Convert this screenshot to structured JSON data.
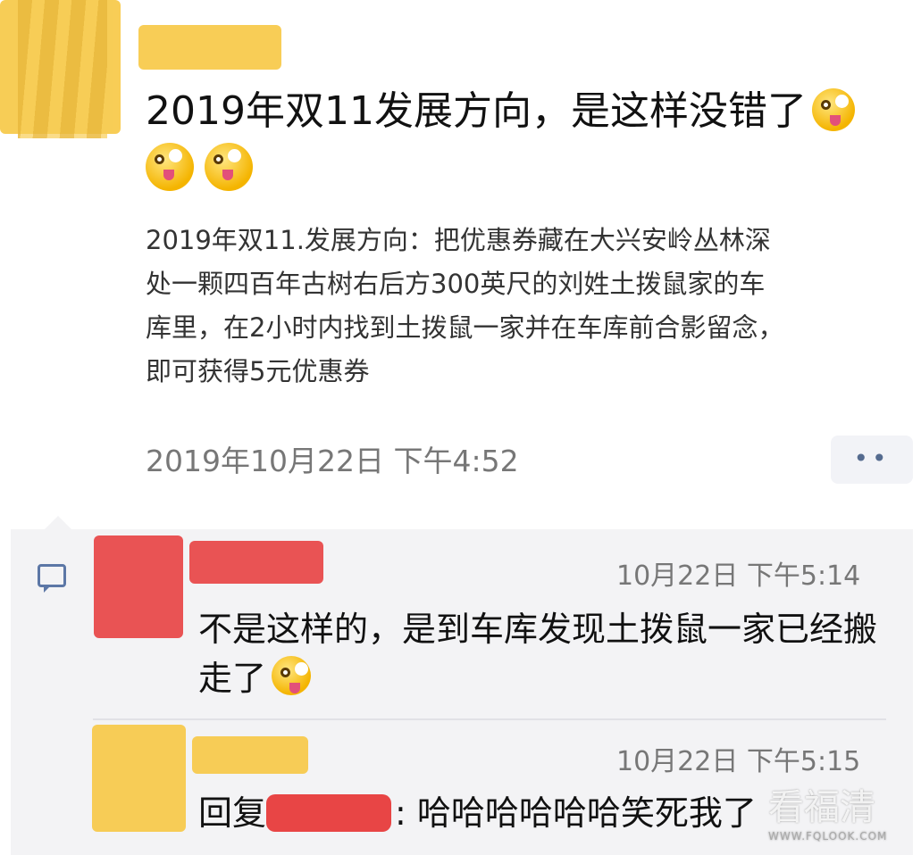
{
  "post": {
    "text": "2019年双11发展方向，是这样没错了",
    "link_text": "2019年双11.发展方向：把优惠券藏在大兴安岭丛林深处一颗四百年古树右后方300英尺的刘姓土拨鼠家的车库里，在2小时内找到土拨鼠一家并在车库前合影留念，即可获得5元优惠券",
    "timestamp": "2019年10月22日 下午4:52",
    "more_label": "••"
  },
  "comments": [
    {
      "time": "10月22日 下午5:14",
      "text": "不是这样的，是到车库发现土拨鼠一家已经搬走了"
    },
    {
      "time": "10月22日 下午5:15",
      "reply_prefix": "回复",
      "text": ": 哈哈哈哈哈哈笑死我了"
    }
  ],
  "watermark": {
    "title": "看福清",
    "url": "WWW.FQLOOK.COM"
  },
  "icons": [
    "zany-face-emoji",
    "smile-emoji",
    "comment-icon"
  ],
  "colors": {
    "redaction_yellow": "#f7c948",
    "redaction_red": "#e84545",
    "link_blue": "#5c77a6"
  }
}
